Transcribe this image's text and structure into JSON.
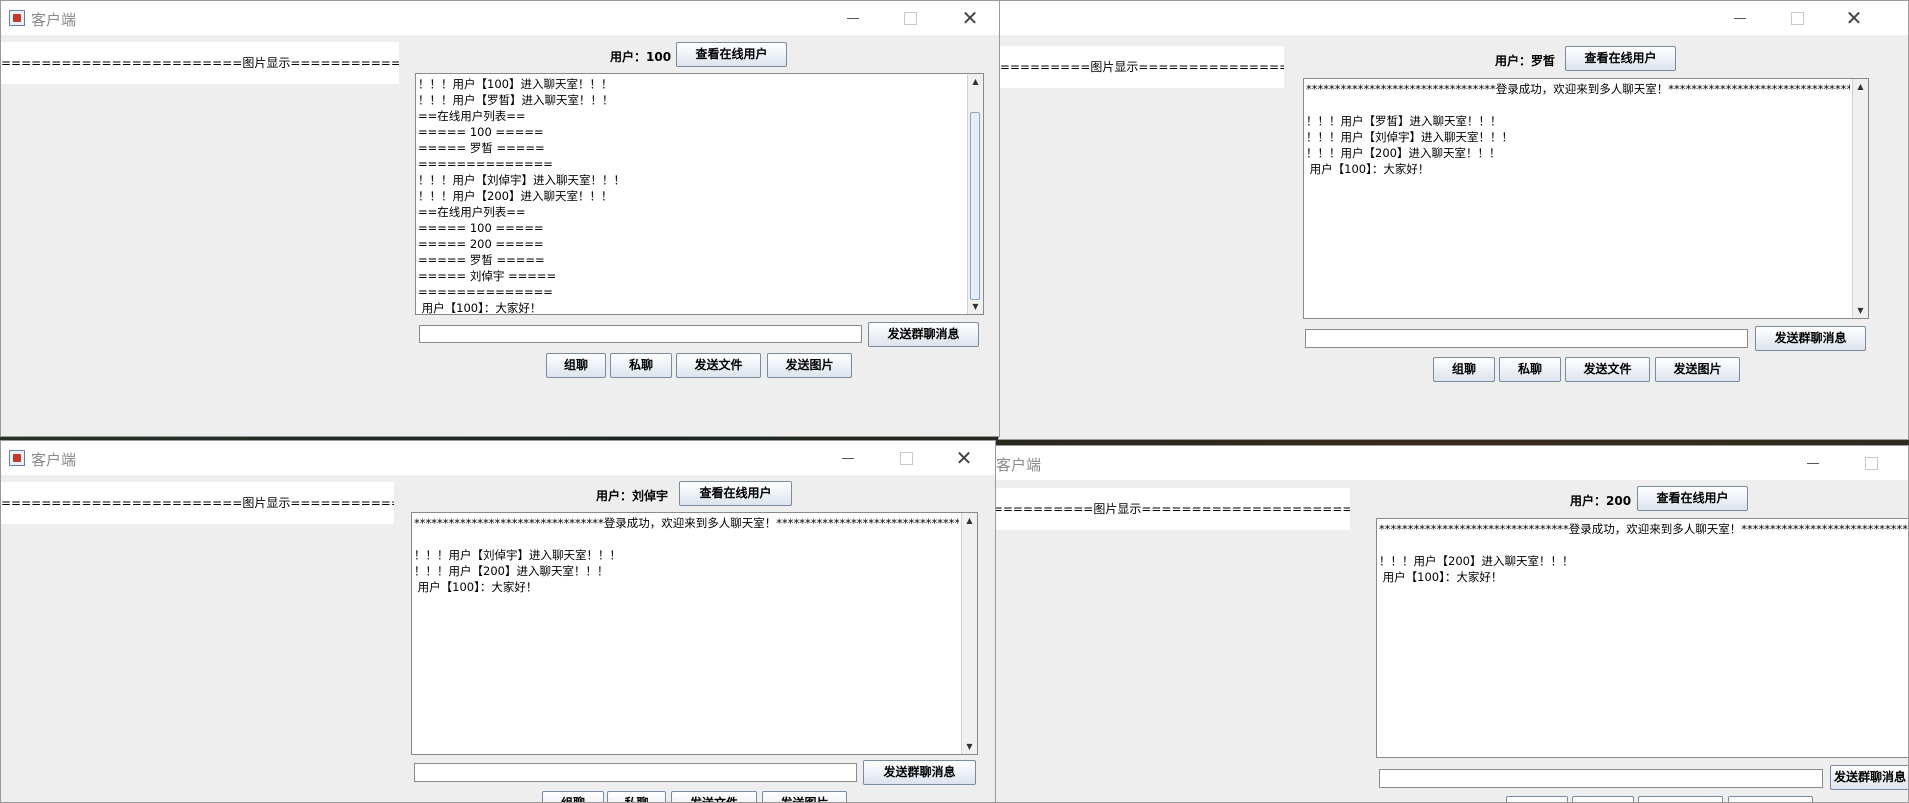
{
  "app": {
    "title": "客户端",
    "image_area_label": "========================图片显示========================"
  },
  "buttons": {
    "online_users": "查看在线用户",
    "send_group": "发送群聊消息",
    "group_chat": "组聊",
    "private_chat": "私聊",
    "send_file": "发送文件",
    "send_image": "发送图片"
  },
  "windows": [
    {
      "user_label": "用户：100",
      "messages": [
        "！！！用户【100】进入聊天室！！！",
        "！！！用户【罗皙】进入聊天室！！！",
        "==在线用户列表==",
        "===== 100 =====",
        "===== 罗皙 =====",
        "==============",
        "！！！用户【刘倬宇】进入聊天室！！！",
        "！！！用户【200】进入聊天室！！！",
        "==在线用户列表==",
        "===== 100 =====",
        "===== 200 =====",
        "===== 罗皙 =====",
        "===== 刘倬宇 =====",
        "==============",
        " 用户【100】：大家好！"
      ]
    },
    {
      "user_label": "用户：罗皙",
      "messages": [
        "*********************************登录成功，欢迎来到多人聊天室！*********************************",
        "",
        "！！！用户【罗皙】进入聊天室！！！",
        "！！！用户【刘倬宇】进入聊天室！！！",
        "！！！用户【200】进入聊天室！！！",
        " 用户【100】：大家好！"
      ]
    },
    {
      "user_label": "用户：刘倬宇",
      "messages": [
        "*********************************登录成功，欢迎来到多人聊天室！*********************************",
        "",
        "！！！用户【刘倬宇】进入聊天室！！！",
        "！！！用户【200】进入聊天室！！！",
        " 用户【100】：大家好！"
      ]
    },
    {
      "user_label": "用户：200",
      "messages": [
        "*********************************登录成功，欢迎来到多人聊天室！*********************************",
        "",
        "！！！用户【200】进入聊天室！！！",
        " 用户【100】：大家好！"
      ]
    }
  ]
}
